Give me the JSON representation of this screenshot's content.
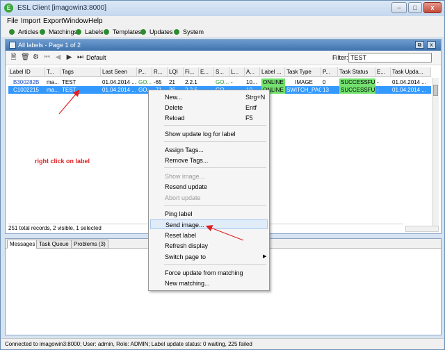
{
  "window": {
    "title": "ESL Client [imagowin3:8000]",
    "app_icon": "E",
    "minimize": "–",
    "maximize": "□",
    "close": "x"
  },
  "menubar": {
    "items": [
      "File",
      "Import",
      "Export",
      "Window",
      "Help"
    ]
  },
  "navbar": {
    "items": [
      "Articles",
      "Matchings",
      "Labels",
      "Templates",
      "Updates",
      "System"
    ]
  },
  "panel": {
    "title": "All labels - Page 1 of 2",
    "restore": "⧉",
    "close": "x"
  },
  "toolbar": {
    "default_label": "Default",
    "filter_label": "Filter:",
    "filter_value": "TEST"
  },
  "table": {
    "columns": [
      "Label ID",
      "T...",
      "Tags",
      "Last Seen",
      "P...",
      "R...",
      "LQI",
      "Fi...",
      "E...",
      "S...",
      "L...",
      "A...",
      "Label ...",
      "Task Type",
      "P...",
      "Task Status",
      "E...",
      "Task Upda..."
    ],
    "rows": [
      [
        "B300282B",
        "ma...",
        "TEST",
        "01.04.2014 ...",
        "GO...",
        "-65",
        "21",
        "2.2.1",
        "",
        "GO...",
        "-",
        "10...",
        "ONLINE",
        "IMAGE",
        "0",
        "SUCCESSFUL",
        "-",
        "01.04.2014 ..."
      ],
      [
        "C1002215",
        "ma...",
        "TEST",
        "01.04.2014 ...",
        "GO...",
        "-71",
        "36",
        "2.2.6",
        "",
        "GO...",
        "-",
        "10...",
        "ONLINE",
        "SWITCH_PAGE",
        "13",
        "SUCCESSFUL",
        "-",
        "01.04.2014 ..."
      ]
    ]
  },
  "records_status": "251 total records, 2 visible, 1 selected",
  "bottom_tabs": [
    "Messages",
    "Task Queue",
    "Problems (3)"
  ],
  "statusbar": "Connected to imagowin3:8000; User: admin, Role: ADMIN; Label update status: 0 waiting, 225 failed",
  "context_menu": {
    "new": "New...",
    "new_shortcut": "Strg+N",
    "delete": "Delete",
    "delete_shortcut": "Entf",
    "reload": "Reload",
    "reload_shortcut": "F5",
    "show_log": "Show update log for label",
    "assign_tags": "Assign Tags...",
    "remove_tags": "Remove Tags...",
    "show_image": "Show image...",
    "resend_update": "Resend update",
    "abort_update": "Abort update",
    "ping_label": "Ping label",
    "send_image": "Send image...",
    "reset_label": "Reset label",
    "refresh_display": "Refresh display",
    "switch_page": "Switch page to",
    "force_update": "Force update from matching",
    "new_matching": "New matching..."
  },
  "annotation": "right click on  label",
  "colors": {
    "selected_row": "#3399ff",
    "status_green": "#73e06f",
    "annotation_red": "#e02020"
  }
}
